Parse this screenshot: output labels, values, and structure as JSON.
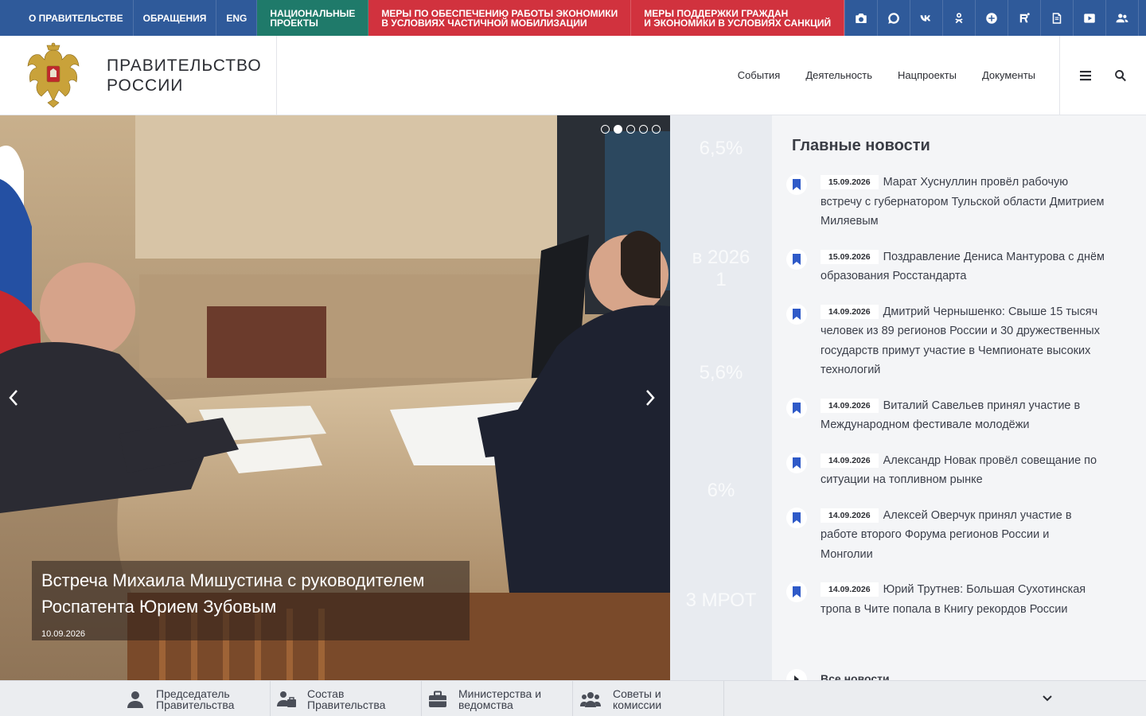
{
  "topbar": {
    "links": [
      "О правительстве",
      "Обращения",
      "ENG"
    ],
    "national_projects": [
      "Национальные",
      "проекты"
    ],
    "mobilization": [
      "Меры по обеспечению работы экономики",
      "в условиях частичной мобилизации"
    ],
    "sanctions": [
      "Меры поддержки граждан",
      "и экономики в условиях санкций"
    ],
    "icons": [
      "camera-icon",
      "chat-icon",
      "vk-icon",
      "odnoklassniki-icon",
      "plus-icon",
      "rutube-icon",
      "dzen-icon",
      "youtube-icon",
      "users-icon",
      "rss-icon"
    ],
    "color_bg": "#2f5a9a",
    "color_np": "#1f7a6a",
    "color_red": "#d1323e"
  },
  "header": {
    "title_line1": "Правительство",
    "title_line2": "России",
    "nav": [
      "События",
      "Деятельность",
      "Нацпроекты",
      "Документы"
    ]
  },
  "hero": {
    "title": "Встреча Михаила Мишустина с руководителем Роспатента Юрием Зубовым",
    "date": "10.09.2026",
    "slides_total": 5,
    "active_slide": 2
  },
  "stats": [
    {
      "big": "6,5%"
    },
    {
      "big": "в 2026",
      "big2": "1"
    },
    {
      "big": "5,6%"
    },
    {
      "big": "6%"
    },
    {
      "big": "3 МРОТ"
    }
  ],
  "news": {
    "title": "Главные новости",
    "items": [
      {
        "date": "15.09.2026",
        "text": "Марат Хуснуллин провёл рабочую встречу с губернатором Тульской области Дмитрием Миляевым"
      },
      {
        "date": "15.09.2026",
        "text": "Поздравление Дениса Мантурова с днём образования Росстандарта"
      },
      {
        "date": "14.09.2026",
        "text": "Дмитрий Чернышенко: Свыше 15 тысяч человек из 89 регионов России и 30 дружественных государств примут участие в Чемпионате высоких технологий"
      },
      {
        "date": "14.09.2026",
        "text": "Виталий Савельев принял участие в Международном фестивале молодёжи"
      },
      {
        "date": "14.09.2026",
        "text": "Александр Новак провёл совещание по ситуации на топливном рынке"
      },
      {
        "date": "14.09.2026",
        "text": "Алексей Оверчук принял участие в работе второго Форума регионов России и Монголии"
      },
      {
        "date": "14.09.2026",
        "text": "Юрий Трутнев: Большая Сухотинская тропа в Чите попала в Книгу рекордов России"
      }
    ],
    "all_news": "Все новости"
  },
  "bottombar": {
    "items": [
      {
        "line1": "Председатель",
        "line2": "Правительства",
        "icon": "person-icon"
      },
      {
        "line1": "Состав",
        "line2": "Правительства",
        "icon": "group-icon"
      },
      {
        "line1": "Министерства и",
        "line2": "ведомства",
        "icon": "briefcase-icon"
      },
      {
        "line1": "Советы и комиссии",
        "line2": "",
        "icon": "people-icon"
      }
    ]
  }
}
